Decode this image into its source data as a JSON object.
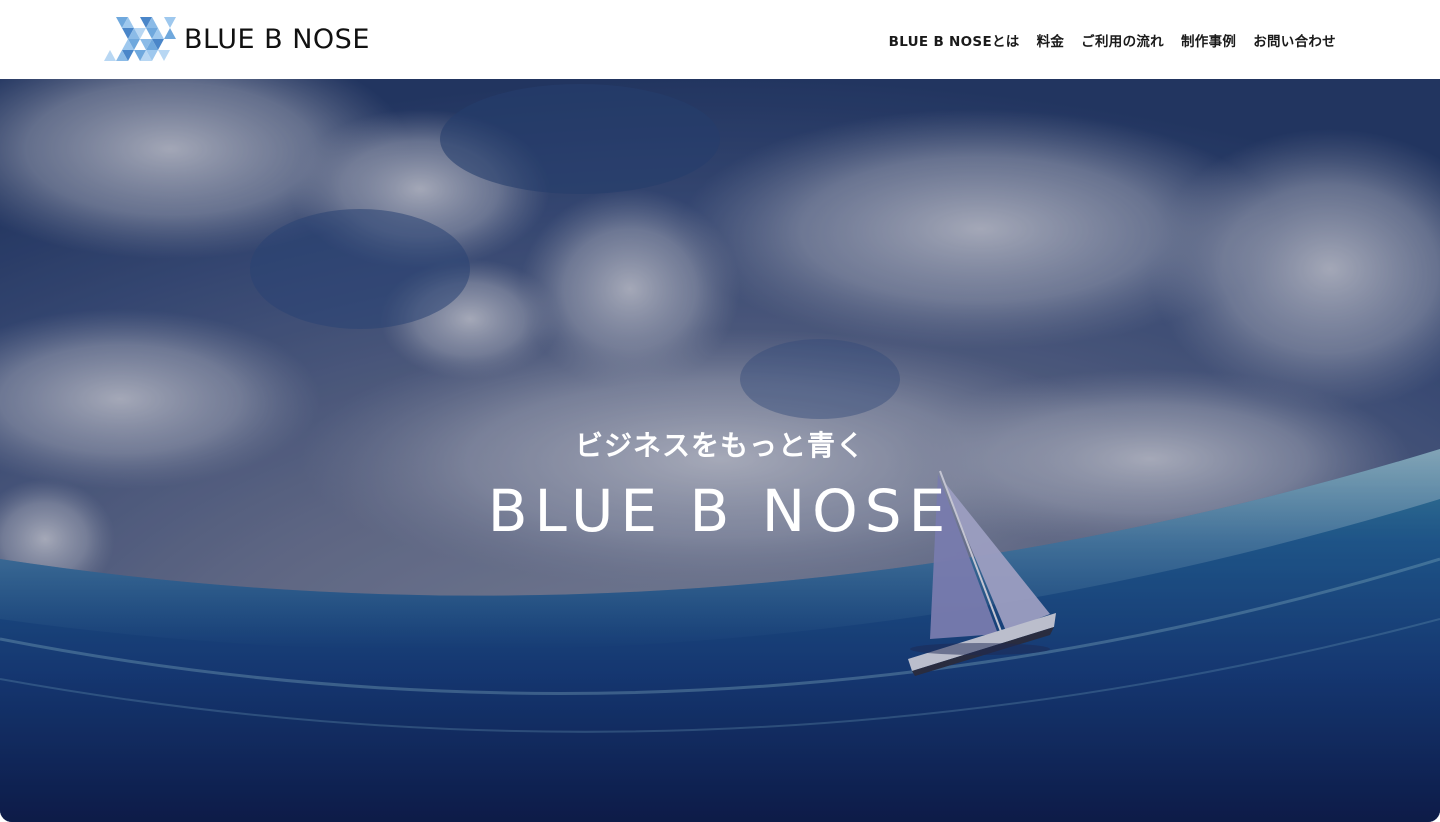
{
  "header": {
    "logo_text": "BLUE B NOSE",
    "logo_icon": "chevron-triangles-logo",
    "nav": [
      {
        "label": "BLUE B NOSEとは"
      },
      {
        "label": "料金"
      },
      {
        "label": "ご利用の流れ"
      },
      {
        "label": "制作事例"
      },
      {
        "label": "お問い合わせ"
      }
    ]
  },
  "hero": {
    "tagline": "ビジネスをもっと青く",
    "title": "BLUE B NOSE",
    "image": "sky-and-ocean-with-sailboat"
  },
  "colors": {
    "logo_light": "#9ec8ee",
    "logo_mid": "#6fa8dd",
    "logo_dark": "#4a86c9",
    "text_dark": "#1a1a1a",
    "sky_deep": "#2f4673",
    "ocean_deep": "#0b1a4a"
  }
}
